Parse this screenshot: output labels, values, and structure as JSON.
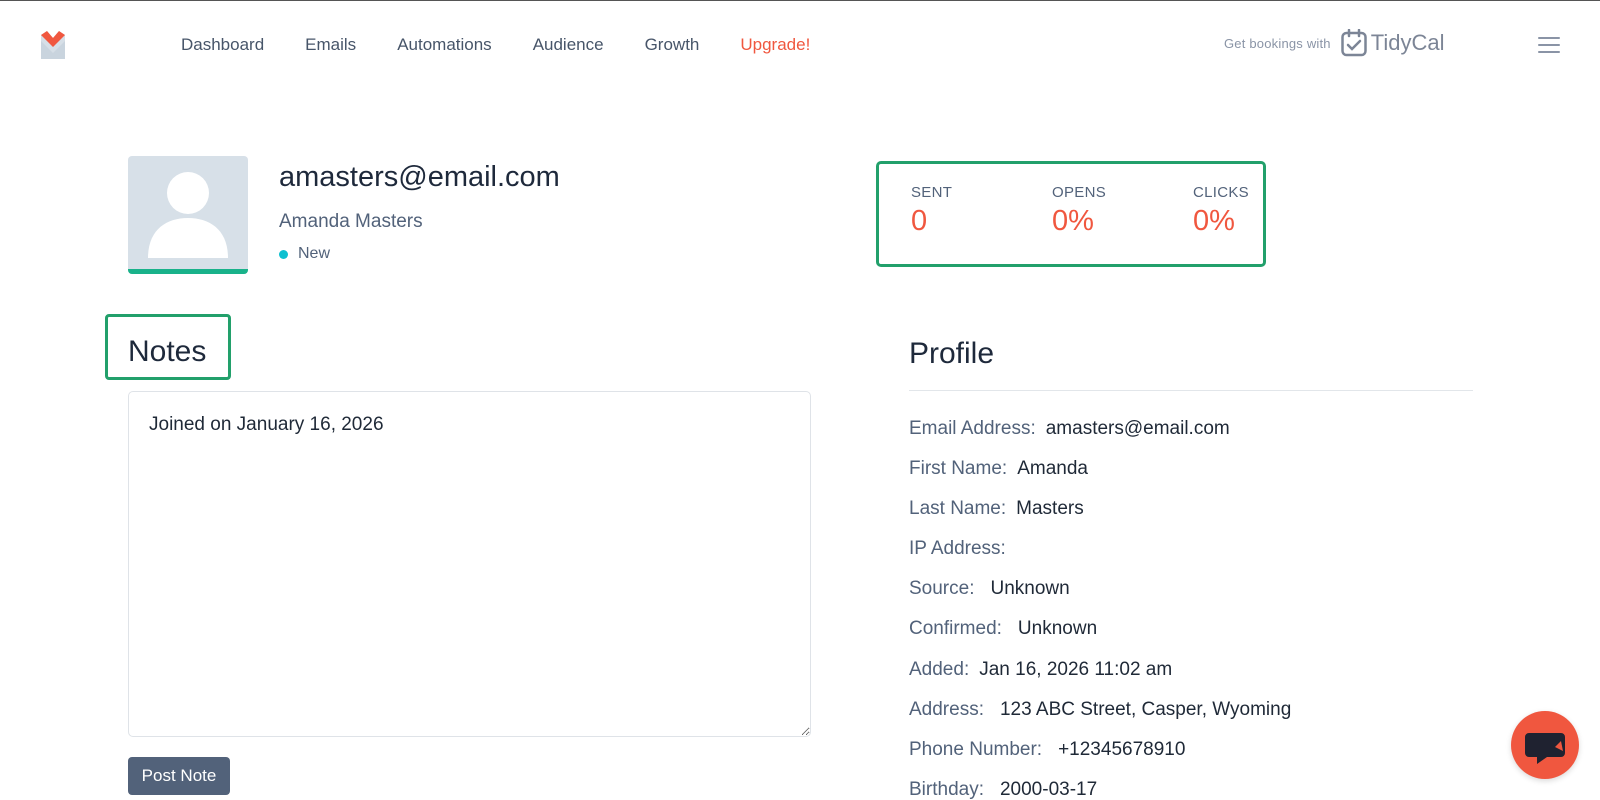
{
  "nav": {
    "items": [
      {
        "label": "Dashboard"
      },
      {
        "label": "Emails"
      },
      {
        "label": "Automations"
      },
      {
        "label": "Audience"
      },
      {
        "label": "Growth"
      },
      {
        "label": "Upgrade!"
      }
    ],
    "bookings_text": "Get bookings with",
    "bookings_brand": "TidyCal"
  },
  "subscriber": {
    "email": "amasters@email.com",
    "name": "Amanda Masters",
    "status": "New"
  },
  "stats": [
    {
      "label": "SENT",
      "value": "0"
    },
    {
      "label": "OPENS",
      "value": "0%"
    },
    {
      "label": "CLICKS",
      "value": "0%"
    }
  ],
  "notes": {
    "title": "Notes",
    "content": "Joined on January 16, 2026",
    "button": "Post Note"
  },
  "profile": {
    "title": "Profile",
    "fields": [
      {
        "label": "Email Address:",
        "value": "amasters@email.com"
      },
      {
        "label": "First Name:",
        "value": "Amanda"
      },
      {
        "label": "Last Name:",
        "value": "Masters"
      },
      {
        "label": "IP Address:",
        "value": ""
      },
      {
        "label": "Source:",
        "value": "Unknown"
      },
      {
        "label": "Confirmed:",
        "value": "Unknown"
      },
      {
        "label": "Added:",
        "value": "Jan 16, 2026 11:02 am"
      },
      {
        "label": "Address:",
        "value": "123 ABC Street, Casper, Wyoming"
      },
      {
        "label": "Phone Number:",
        "value": "+12345678910"
      },
      {
        "label": "Birthday:",
        "value": "2000-03-17"
      }
    ]
  },
  "colors": {
    "accent": "#f0573f",
    "highlight_box": "#22a06b",
    "status_dot": "#0ec0d0"
  },
  "icons": {
    "logo": "fox-mail-logo",
    "tidycal": "calendar-check-icon",
    "menu": "hamburger-menu-icon",
    "chat": "chat-bubble-icon"
  }
}
